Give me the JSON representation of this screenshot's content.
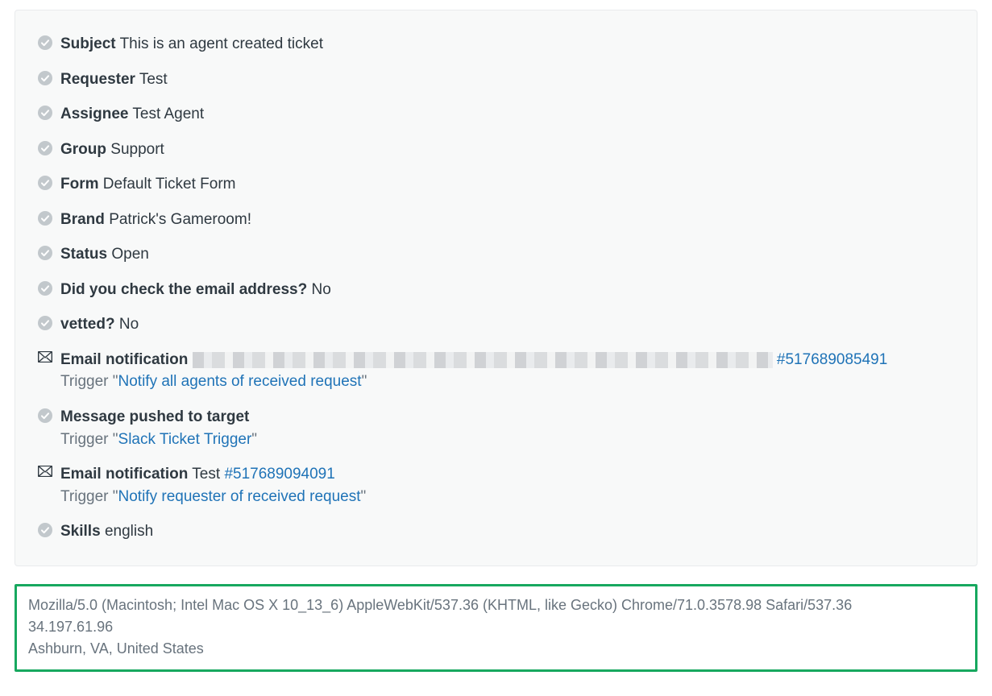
{
  "rows": {
    "subject": {
      "label": "Subject",
      "value": "This is an agent created ticket"
    },
    "requester": {
      "label": "Requester",
      "value": "Test"
    },
    "assignee": {
      "label": "Assignee",
      "value": "Test Agent"
    },
    "group": {
      "label": "Group",
      "value": "Support"
    },
    "form": {
      "label": "Form",
      "value": "Default Ticket Form"
    },
    "brand": {
      "label": "Brand",
      "value": "Patrick's Gameroom!"
    },
    "status": {
      "label": "Status",
      "value": "Open"
    },
    "emailq": {
      "label": "Did you check the email address?",
      "value": "No"
    },
    "vetted": {
      "label": "vetted?",
      "value": "No"
    },
    "skills": {
      "label": "Skills",
      "value": "english"
    }
  },
  "notif1": {
    "label": "Email notification",
    "ticket": "#517689085491",
    "trigger_prefix": "Trigger \"",
    "trigger_link": "Notify all agents of received request",
    "trigger_suffix": "\""
  },
  "pushed": {
    "label": "Message pushed to target",
    "trigger_prefix": "Trigger \"",
    "trigger_link": "Slack Ticket Trigger",
    "trigger_suffix": "\""
  },
  "notif2": {
    "label": "Email notification",
    "value": "Test",
    "ticket": "#517689094091",
    "trigger_prefix": "Trigger \"",
    "trigger_link": "Notify requester of received request",
    "trigger_suffix": "\""
  },
  "footer": {
    "ua": "Mozilla/5.0 (Macintosh; Intel Mac OS X 10_13_6) AppleWebKit/537.36 (KHTML, like Gecko) Chrome/71.0.3578.98 Safari/537.36",
    "ip": "34.197.61.96",
    "loc": "Ashburn, VA, United States"
  }
}
